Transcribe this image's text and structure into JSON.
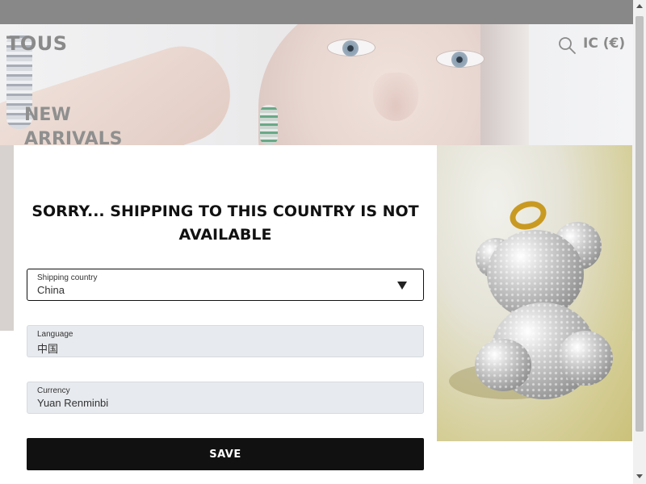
{
  "header": {
    "logo": "TOUS",
    "locale": "IC (€)"
  },
  "hero": {
    "headline": "NEW ARRIVALS"
  },
  "modal": {
    "title": "SORRY... SHIPPING TO THIS COUNTRY IS NOT AVAILABLE",
    "shipping_country": {
      "label": "Shipping country",
      "value": "China"
    },
    "language": {
      "label": "Language",
      "value": "中国"
    },
    "currency": {
      "label": "Currency",
      "value": "Yuan Renminbi"
    },
    "save_label": "SAVE"
  },
  "colors": {
    "topbar": "#888888",
    "button_bg": "#111111",
    "disabled_field_bg": "#e7eaee"
  }
}
